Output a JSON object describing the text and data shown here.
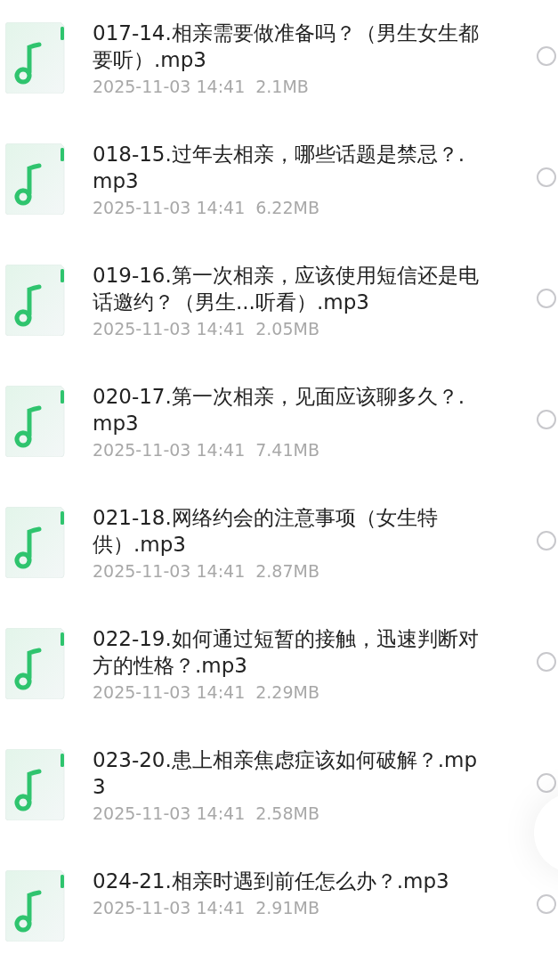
{
  "files": [
    {
      "name": "017-14.相亲需要做准备吗？（男生女生都要听）.mp3",
      "date": "2025-11-03 14:41",
      "size": "2.1MB",
      "selected": false
    },
    {
      "name": "018-15.过年去相亲，哪些话题是禁忌？.mp3",
      "date": "2025-11-03 14:41",
      "size": "6.22MB",
      "selected": false
    },
    {
      "name": "019-16.第一次相亲，应该使用短信还是电话邀约？（男生...听看）.mp3",
      "date": "2025-11-03 14:41",
      "size": "2.05MB",
      "selected": false
    },
    {
      "name": "020-17.第一次相亲，见面应该聊多久？.mp3",
      "date": "2025-11-03 14:41",
      "size": "7.41MB",
      "selected": false
    },
    {
      "name": "021-18.网络约会的注意事项（女生特供）.mp3",
      "date": "2025-11-03 14:41",
      "size": "2.87MB",
      "selected": false
    },
    {
      "name": "022-19.如何通过短暂的接触，迅速判断对方的性格？.mp3",
      "date": "2025-11-03 14:41",
      "size": "2.29MB",
      "selected": false
    },
    {
      "name": "023-20.患上相亲焦虑症该如何破解？.mp3",
      "date": "2025-11-03 14:41",
      "size": "2.58MB",
      "selected": false
    },
    {
      "name": "024-21.相亲时遇到前任怎么办？.mp3",
      "date": "2025-11-03 14:41",
      "size": "2.91MB",
      "selected": false
    }
  ]
}
